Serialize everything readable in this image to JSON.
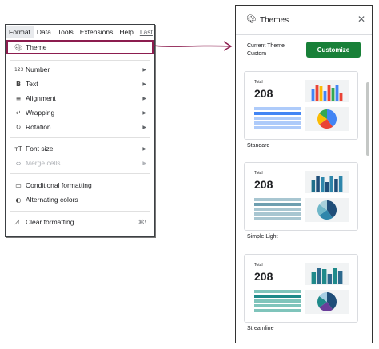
{
  "menubar": {
    "items": [
      "Format",
      "Data",
      "Tools",
      "Extensions",
      "Help"
    ],
    "last_edit": "Last"
  },
  "menu": {
    "theme": {
      "label": "Theme",
      "icon": "palette-icon"
    },
    "number": {
      "label": "Number",
      "icon": "123-icon",
      "icon_text": "123"
    },
    "text": {
      "label": "Text",
      "icon": "bold-icon",
      "icon_text": "B"
    },
    "alignment": {
      "label": "Alignment",
      "icon": "align-icon"
    },
    "wrapping": {
      "label": "Wrapping",
      "icon": "wrap-icon"
    },
    "rotation": {
      "label": "Rotation",
      "icon": "rotate-icon"
    },
    "font_size": {
      "label": "Font size",
      "icon": "font-size-icon",
      "icon_text": "тT"
    },
    "merge_cells": {
      "label": "Merge cells",
      "icon": "merge-icon",
      "disabled": true
    },
    "conditional_formatting": {
      "label": "Conditional formatting",
      "icon": "paint-roller-icon"
    },
    "alternating_colors": {
      "label": "Alternating colors",
      "icon": "contrast-icon"
    },
    "clear_formatting": {
      "label": "Clear formatting",
      "icon": "clear-format-icon",
      "shortcut": "⌘\\"
    }
  },
  "themes_panel": {
    "title": "Themes",
    "current_theme_label": "Current Theme",
    "current_theme_value": "Custom",
    "customize_label": "Customize",
    "cards": [
      {
        "name": "Standard",
        "total_label": "Total",
        "total_value": "208",
        "bar_colors": [
          "#4285f4",
          "#ea4335",
          "#fbbc04",
          "#4285f4",
          "#ea4335",
          "#34a853",
          "#4285f4",
          "#ea4335"
        ],
        "pie_colors": [
          "#4285f4",
          "#ea4335",
          "#fbbc04",
          "#34a853"
        ],
        "table_colors": [
          "#aecbfa",
          "#4285f4"
        ]
      },
      {
        "name": "Simple Light",
        "total_label": "Total",
        "total_value": "208",
        "bar_colors": [
          "#1f6f8b",
          "#1f4e79",
          "#2e86ab",
          "#1f4e79",
          "#2e86ab",
          "#1f4e79",
          "#2e86ab"
        ],
        "pie_colors": [
          "#1f4e79",
          "#2e86ab",
          "#6fb7c9",
          "#a8d0db"
        ],
        "table_colors": [
          "#a8c6d1",
          "#6e9fb0"
        ]
      },
      {
        "name": "Streamline",
        "total_label": "Total",
        "total_value": "208",
        "bar_colors": [
          "#1f8a8a",
          "#2e6a8e",
          "#1f8a8a",
          "#2e6a8e",
          "#1f8a8a",
          "#2e6a8e"
        ],
        "pie_colors": [
          "#1f4e79",
          "#6a3d9a",
          "#1f8a8a",
          "#a6cee3"
        ],
        "table_colors": [
          "#7fc4bb",
          "#1f8a8a"
        ]
      }
    ]
  },
  "colors": {
    "highlight": "#8c1d4f",
    "customize_button": "#188038"
  }
}
